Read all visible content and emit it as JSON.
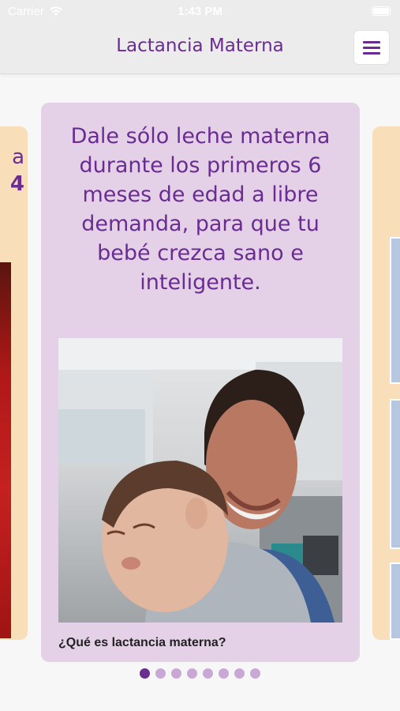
{
  "status_bar": {
    "carrier": "Carrier",
    "time": "1:43 PM"
  },
  "nav": {
    "title": "Lactancia Materna",
    "menu_icon": "hamburger-menu-icon"
  },
  "left_card": {
    "line1": "a",
    "line2": "4"
  },
  "main_card": {
    "text": "Dale sólo leche materna durante los primeros 6 meses de edad a libre demanda, para que tu bebé crezca sano e inteligente.",
    "caption": "¿Qué es lactancia materna?"
  },
  "pager": {
    "total": 8,
    "active": 0
  },
  "colors": {
    "brand_purple": "#6a2c91",
    "card_lilac": "#e4d1e8",
    "side_card_peach": "#f9deba",
    "inactive_dot": "#c9a8d6"
  }
}
